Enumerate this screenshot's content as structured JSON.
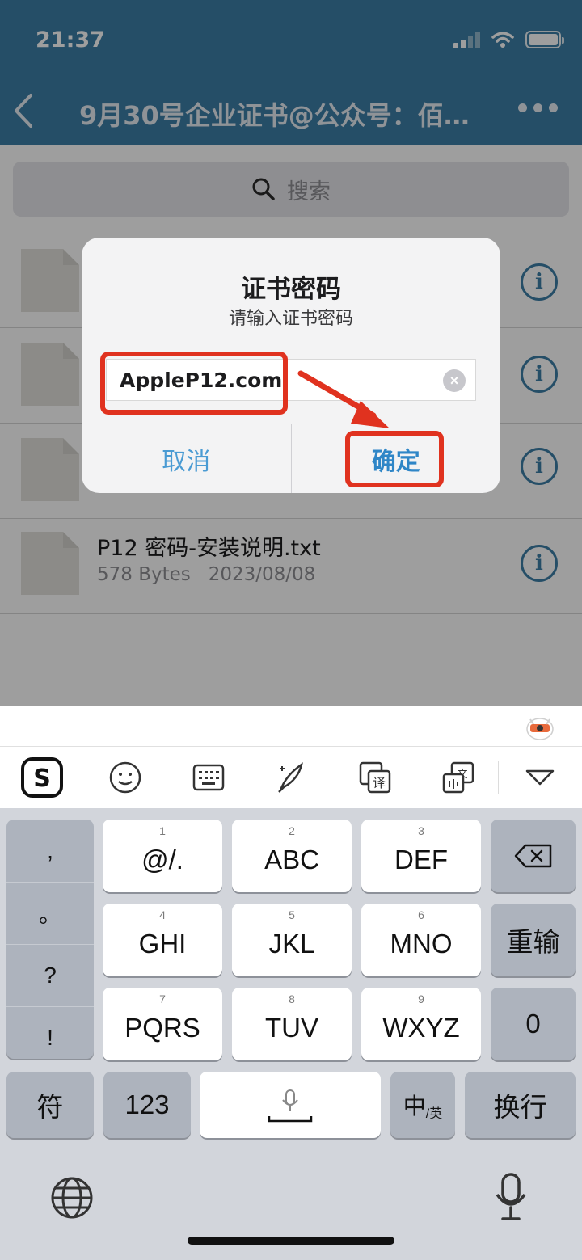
{
  "status_bar": {
    "time": "21:37"
  },
  "nav": {
    "title": "9月30号企业证书@公众号：佰…"
  },
  "search": {
    "placeholder": "搜索"
  },
  "files": [
    {
      "name": "P12 密码-安装说明.txt",
      "size": "578 Bytes",
      "date": "2023/08/08"
    }
  ],
  "dialog": {
    "title": "证书密码",
    "subtitle": "请输入证书密码",
    "input_value": "AppleP12.com",
    "cancel_label": "取消",
    "confirm_label": "确定"
  },
  "keyboard": {
    "punctuation": [
      ",",
      "。",
      "?",
      "!"
    ],
    "keys": [
      {
        "num": "1",
        "label": "@/."
      },
      {
        "num": "2",
        "label": "ABC"
      },
      {
        "num": "3",
        "label": "DEF"
      },
      {
        "num": "4",
        "label": "GHI"
      },
      {
        "num": "5",
        "label": "JKL"
      },
      {
        "num": "6",
        "label": "MNO"
      },
      {
        "num": "7",
        "label": "PQRS"
      },
      {
        "num": "8",
        "label": "TUV"
      },
      {
        "num": "9",
        "label": "WXYZ"
      }
    ],
    "retype_label": "重输",
    "zero_label": "0",
    "symbols_label": "符",
    "numbers_label": "123",
    "lang_main": "中",
    "lang_sub": "/英",
    "return_label": "换行"
  },
  "colors": {
    "header": "#3d7ea6",
    "highlight": "#e0321f",
    "dialog_button": "#2f86c7"
  }
}
